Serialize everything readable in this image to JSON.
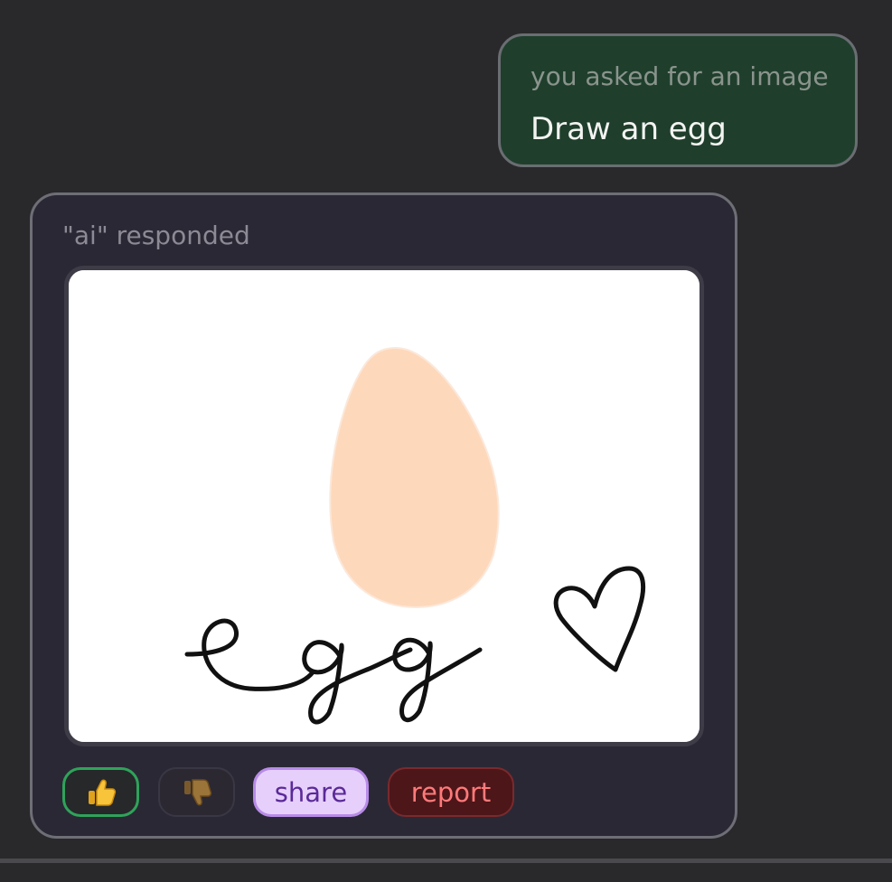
{
  "user_message": {
    "caption": "you asked for an image",
    "text": "Draw an egg"
  },
  "ai_response": {
    "caption": "\"ai\" responded",
    "image": {
      "drawing_text": "egg",
      "colors": {
        "egg_fill": "#fed8bb",
        "ink": "#111111",
        "background": "#ffffff"
      }
    }
  },
  "actions": {
    "like_icon": "thumbs-up-icon",
    "dislike_icon": "thumbs-down-icon",
    "share_label": "share",
    "report_label": "report"
  },
  "colors": {
    "background": "#29292b",
    "user_bubble": "#1f3f2c",
    "ai_card": "#2b2835",
    "like_border": "#2fa35a",
    "share_bg": "#e6d0fb",
    "report_bg": "#4d1619"
  }
}
